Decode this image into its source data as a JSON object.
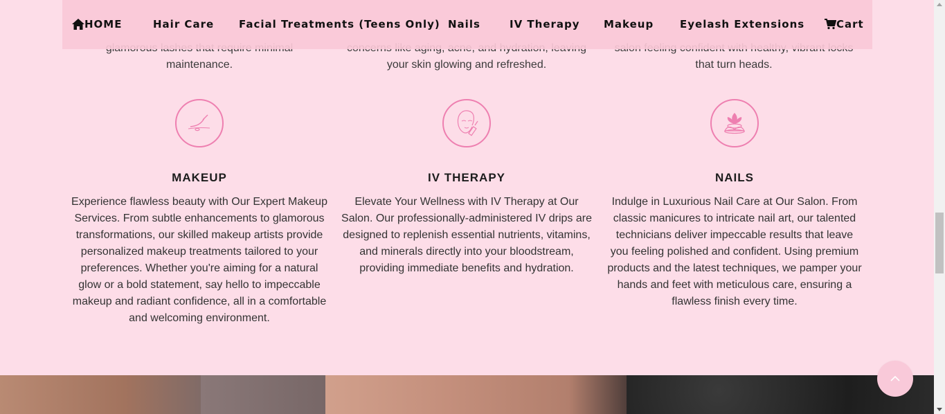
{
  "nav": {
    "home": "HOME",
    "items": [
      "Hair Care",
      "Facial Treatments (Teens Only)",
      "Nails",
      "IV Therapy",
      "Makeup",
      "Eyelash Extensions"
    ],
    "cart": "Cart"
  },
  "top_row": [
    {
      "line1": "glamorous lashes that require minimal",
      "line2": "maintenance."
    },
    {
      "line1": "concerns like aging, acne, and hydration, leaving",
      "line2": "your skin glowing and refreshed."
    },
    {
      "line1": "salon feeling confident with healthy, vibrant locks",
      "line2": "that turn heads."
    }
  ],
  "services": [
    {
      "icon": "lash-brush-icon",
      "title": "MAKEUP",
      "text": "Experience flawless beauty with Our Expert Makeup Services. From subtle enhancements to glamorous transformations, our skilled makeup artists provide personalized makeup treatments tailored to your preferences. Whether you're aiming for a natural glow or a bold statement, say hello to impeccable makeup and radiant confidence, all in a comfortable and welcoming environment."
    },
    {
      "icon": "face-serum-icon",
      "title": "IV THERAPY",
      "text": "Elevate Your Wellness with IV Therapy at Our Salon. Our professionally-administered IV drips are designed to replenish essential nutrients, vitamins, and minerals directly into your bloodstream, providing immediate benefits and hydration."
    },
    {
      "icon": "lotus-stones-icon",
      "title": "NAILS",
      "text": "Indulge in Luxurious Nail Care at Our Salon. From classic manicures to intricate nail art, our talented technicians deliver impeccable results that leave you feeling polished and confident. Using premium products and the latest techniques, we pamper your hands and feet with meticulous care, ensuring a flawless finish every time."
    }
  ],
  "colors": {
    "background": "#fddde8",
    "nav_background": "#fac8d7",
    "accent": "#ee7fb0"
  }
}
